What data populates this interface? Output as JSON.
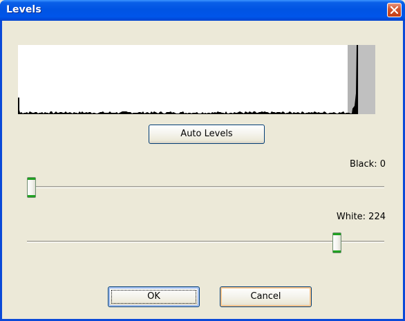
{
  "window": {
    "title": "Levels",
    "close_icon": "close-icon"
  },
  "histogram": {
    "white_point_fraction": 0.878
  },
  "buttons": {
    "auto_levels": "Auto Levels",
    "ok": "OK",
    "cancel": "Cancel"
  },
  "black": {
    "label": "Black: 0",
    "value": 0
  },
  "white": {
    "label": "White: 224",
    "value": 224
  },
  "colors": {
    "titlebar": "#0054e3",
    "close_button": "#c43e16",
    "slider_thumb_accent": "#21a121",
    "dialog_background": "#ece9d8"
  }
}
